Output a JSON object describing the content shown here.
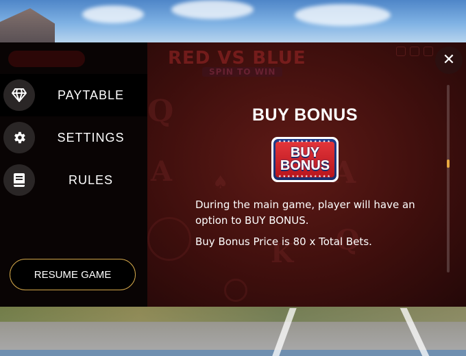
{
  "menu": {
    "items": [
      {
        "label": "PAYTABLE",
        "icon": "diamond-icon",
        "active": true
      },
      {
        "label": "SETTINGS",
        "icon": "gear-icon",
        "active": false
      },
      {
        "label": "RULES",
        "icon": "book-icon",
        "active": false
      }
    ],
    "resume_label": "RESUME GAME"
  },
  "content": {
    "title": "BUY BONUS",
    "badge": {
      "line1": "BUY",
      "line2": "BONUS"
    },
    "paragraph1": "During the main game, player will have an option to BUY BONUS.",
    "paragraph2": "Buy Bonus Price is 80 x Total Bets."
  },
  "close_icon": "close-icon",
  "colors": {
    "accent_gold": "#d4a84a",
    "scroll_thumb": "#e8a840",
    "badge_red": "#e2353a",
    "badge_blue": "#1f3b8a"
  }
}
